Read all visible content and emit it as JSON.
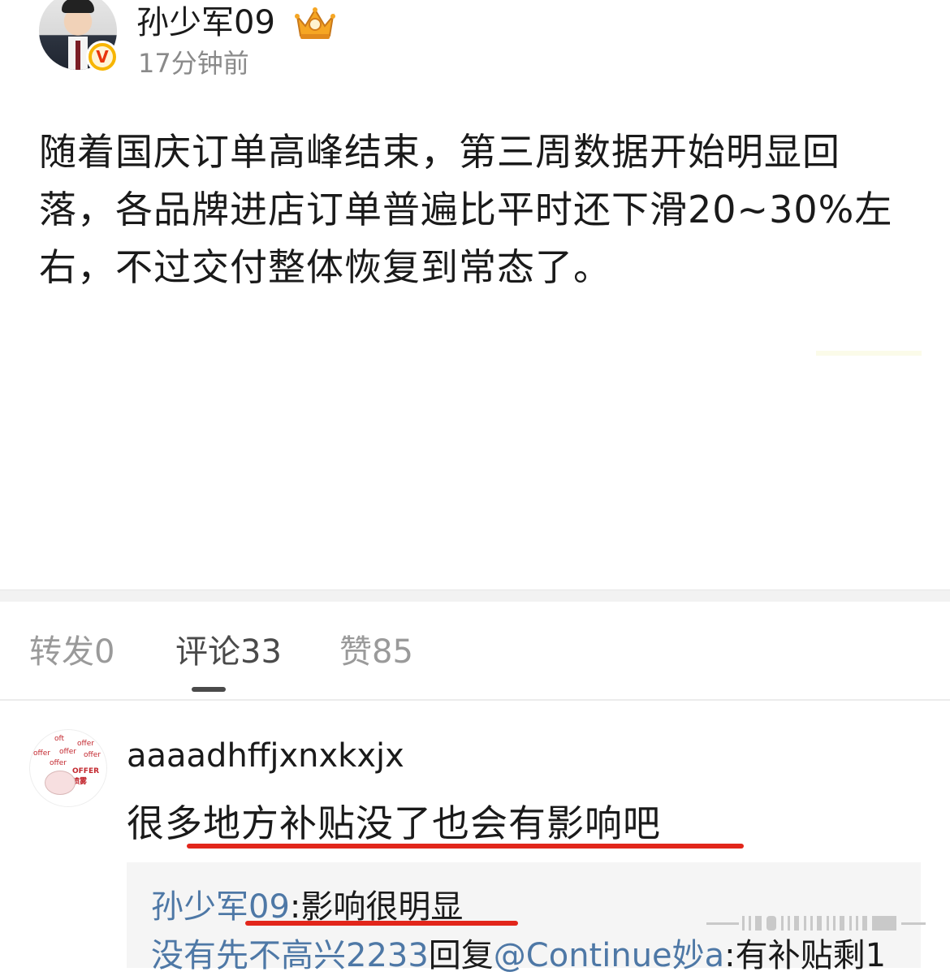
{
  "post": {
    "username": "孙少军09",
    "time": "17分钟前",
    "text": "随着国庆订单高峰结束，第三周数据开始明显回落，各品牌进店订单普遍比平时还下滑20~30%左右，不过交付整体恢复到常态了。"
  },
  "icons": {
    "verified": "verified-v-badge-icon",
    "crown": "vip-crown-icon"
  },
  "tabs": [
    {
      "label": "转发0"
    },
    {
      "label": "评论33"
    },
    {
      "label": "赞85"
    }
  ],
  "comment": {
    "username": "aaaadhffjxnxkxjx",
    "text": "很多地方补贴没了也会有影响吧",
    "avatar_caption": "OFFER喷雾",
    "replies": [
      {
        "author": "孙少军09",
        "text": ":影响很明显"
      },
      {
        "author": "没有先不高兴2233",
        "middle": "回复",
        "mention": "@Continue妙a",
        "text": ":有补贴剩1"
      }
    ]
  },
  "colors": {
    "link_blue": "#4e78a6",
    "highlight_red": "#e2261b",
    "verified_gold": "#f7b500"
  }
}
